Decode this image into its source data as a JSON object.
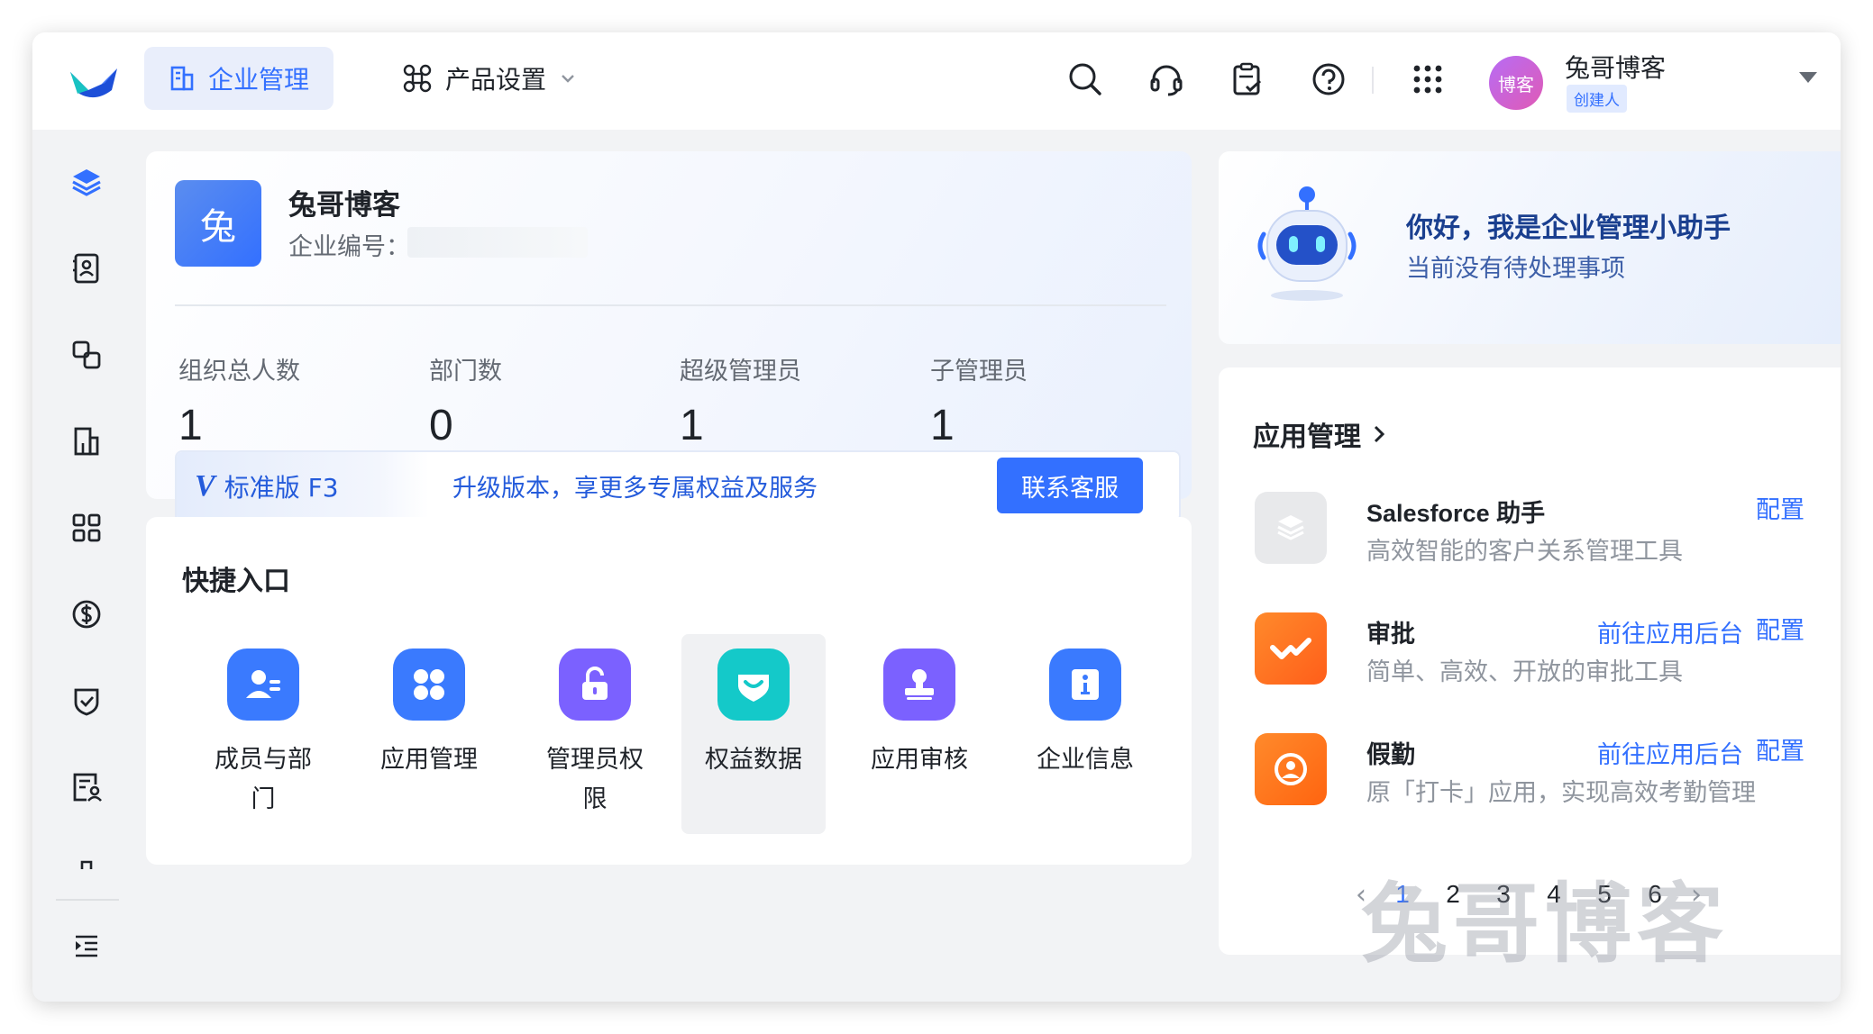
{
  "topbar": {
    "tab_company": "企业管理",
    "tab_product": "产品设置",
    "icons": [
      "search-icon",
      "headset-icon",
      "clipboard-check-icon",
      "help-icon",
      "apps-grid-icon"
    ],
    "user": {
      "avatar_text": "博客",
      "name": "兔哥博客",
      "role": "创建人"
    }
  },
  "sidebar": {
    "items": [
      "layers-icon",
      "contacts-icon",
      "link-icon",
      "building-icon",
      "grid-icon",
      "dollar-icon",
      "shield-check-icon",
      "user-form-icon",
      "collapse-menu-icon"
    ]
  },
  "org": {
    "logo_text": "兔",
    "name": "兔哥博客",
    "id_label": "企业编号：",
    "stats": [
      {
        "label": "组织总人数",
        "value": "1"
      },
      {
        "label": "部门数",
        "value": "0"
      },
      {
        "label": "超级管理员",
        "value": "1"
      },
      {
        "label": "子管理员",
        "value": "1"
      }
    ],
    "plan_logo": "V",
    "plan": "标准版 F3",
    "upgrade_text": "升级版本，享更多专属权益及服务",
    "contact_button": "联系客服"
  },
  "quick": {
    "title": "快捷入口",
    "items": [
      {
        "label": "成员与部门",
        "icon": "member-dept-icon",
        "color": "#3a7afe"
      },
      {
        "label": "应用管理",
        "icon": "app-manage-icon",
        "color": "#3a7afe"
      },
      {
        "label": "管理员权限",
        "icon": "admin-lock-icon",
        "color": "#7b61ff"
      },
      {
        "label": "权益数据",
        "icon": "benefit-data-icon",
        "color": "#14c9c9"
      },
      {
        "label": "应用审核",
        "icon": "app-review-icon",
        "color": "#7b61ff"
      },
      {
        "label": "企业信息",
        "icon": "company-info-icon",
        "color": "#3a7afe"
      }
    ]
  },
  "assistant": {
    "title": "你好，我是企业管理小助手",
    "subtitle": "当前没有待处理事项"
  },
  "apps": {
    "title": "应用管理",
    "list": [
      {
        "name": "Salesforce 助手",
        "desc": "高效智能的客户关系管理工具",
        "goto": "",
        "config": "配置",
        "icon": "salesforce-icon"
      },
      {
        "name": "审批",
        "desc": "简单、高效、开放的审批工具",
        "goto": "前往应用后台",
        "config": "配置",
        "icon": "approval-icon"
      },
      {
        "name": "假勤",
        "desc": "原「打卡」应用，实现高效考勤管理",
        "goto": "前往应用后台",
        "config": "配置",
        "icon": "attendance-icon"
      }
    ],
    "pages": [
      "1",
      "2",
      "3",
      "4",
      "5",
      "6"
    ],
    "current_page": "1"
  },
  "watermark": "兔哥博客"
}
